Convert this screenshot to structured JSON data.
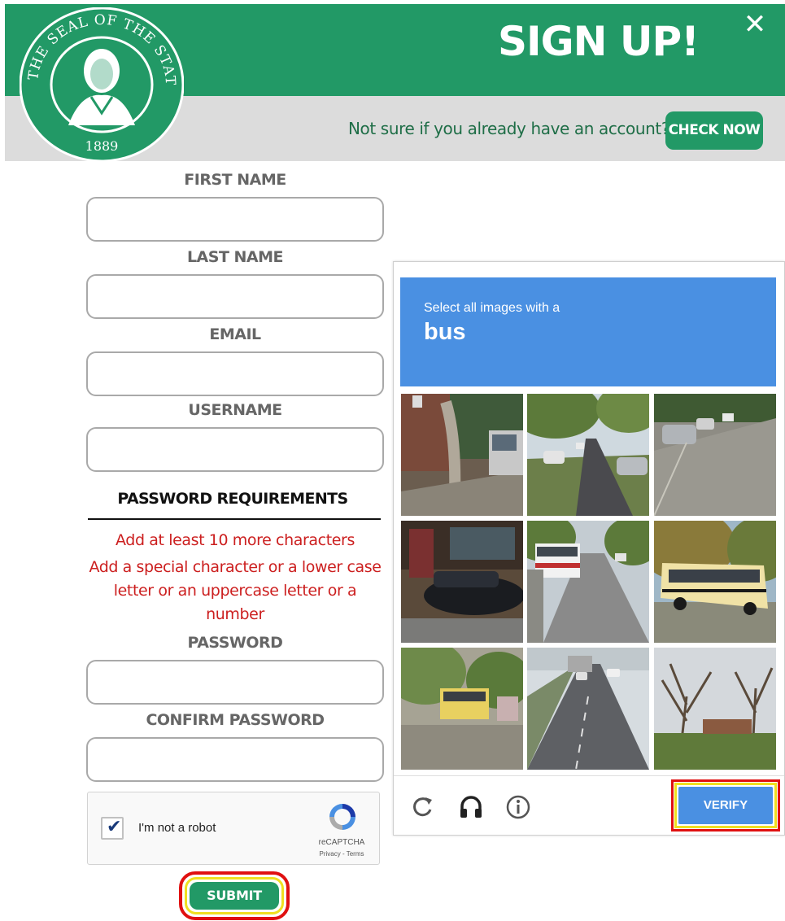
{
  "header": {
    "title": "SIGN UP!",
    "close_glyph": "✕",
    "prompt": "Not sure if you already have an account?",
    "check_now_label": "CHECK NOW",
    "seal_icon": "washington-state-seal",
    "seal_text_top": "THE SEAL OF THE STATE OF WASHINGTON",
    "seal_year": "1889"
  },
  "form": {
    "first_name_label": "FIRST NAME",
    "first_name_value": "",
    "last_name_label": "LAST NAME",
    "last_name_value": "",
    "email_label": "EMAIL",
    "email_value": "",
    "username_label": "USERNAME",
    "username_value": "",
    "password_requirements_title": "PASSWORD REQUIREMENTS",
    "requirement_1": "Add at least 10 more characters",
    "requirement_2": "Add a special character or a lower case letter or an uppercase letter or a number",
    "password_label": "PASSWORD",
    "password_value": "",
    "confirm_password_label": "CONFIRM PASSWORD",
    "confirm_password_value": "",
    "submit_label": "SUBMIT"
  },
  "recaptcha_checkbox": {
    "checked": true,
    "check_glyph": "✔",
    "label": "I'm not a robot",
    "brand": "reCAPTCHA",
    "links": "Privacy - Terms"
  },
  "captcha_challenge": {
    "instruction": "Select all images with a",
    "target": "bus",
    "tiles": [
      {
        "scene": "sidewalk-tree-truck"
      },
      {
        "scene": "tree-lined-street"
      },
      {
        "scene": "parked-cars-street"
      },
      {
        "scene": "storefront-car"
      },
      {
        "scene": "street-with-bus"
      },
      {
        "scene": "school-bus-trees"
      },
      {
        "scene": "yellow-bus-distant"
      },
      {
        "scene": "highway-traffic"
      },
      {
        "scene": "bare-trees-lawn"
      }
    ],
    "reload_icon": "reload-icon",
    "audio_icon": "headphones-icon",
    "info_icon": "info-icon",
    "verify_label": "VERIFY"
  },
  "colors": {
    "brand_green": "#229966",
    "header_grey": "#dcdcdc",
    "captcha_blue": "#4a90e2",
    "error_red": "#cc1f1f",
    "highlight_red": "#e01010",
    "highlight_yellow": "#f0e020"
  }
}
